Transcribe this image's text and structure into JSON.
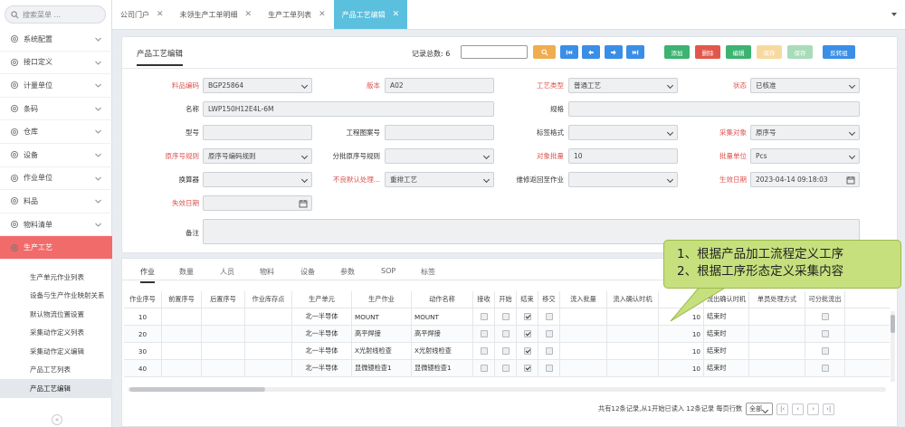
{
  "sidebar": {
    "search_placeholder": "搜索菜单 ...",
    "items": [
      {
        "label": "系统配置",
        "icon": "gear-icon"
      },
      {
        "label": "接口定义",
        "icon": "gear-icon"
      },
      {
        "label": "计量单位",
        "icon": "gear-icon"
      },
      {
        "label": "条码",
        "icon": "gear-icon"
      },
      {
        "label": "仓库",
        "icon": "gear-icon"
      },
      {
        "label": "设备",
        "icon": "gear-icon"
      },
      {
        "label": "作业单位",
        "icon": "gear-icon"
      },
      {
        "label": "料品",
        "icon": "gear-icon"
      },
      {
        "label": "物料清单",
        "icon": "gear-icon"
      },
      {
        "label": "生产工艺",
        "icon": "gear-icon",
        "active": true
      }
    ],
    "subitems": [
      {
        "label": "生产单元作业列表"
      },
      {
        "label": "设备与生产作业映射关系"
      },
      {
        "label": "默认物流位置设置"
      },
      {
        "label": "采集动作定义列表"
      },
      {
        "label": "采集动作定义编辑"
      },
      {
        "label": "产品工艺列表"
      },
      {
        "label": "产品工艺编辑",
        "active": true
      }
    ]
  },
  "tabs": [
    {
      "label": "公司门户"
    },
    {
      "label": "未领生产工单明细"
    },
    {
      "label": "生产工单列表"
    },
    {
      "label": "产品工艺编辑",
      "active": true
    }
  ],
  "panel": {
    "title": "产品工艺编辑",
    "record_label": "记录总数: 6",
    "buttons": [
      {
        "label": "",
        "icon": "search-icon",
        "color": "#f0ad4e"
      },
      {
        "label": "",
        "icon": "first-page-icon",
        "color": "#3a8ee6"
      },
      {
        "label": "",
        "icon": "prev-icon",
        "color": "#3a8ee6"
      },
      {
        "label": "",
        "icon": "next-icon",
        "color": "#3a8ee6"
      },
      {
        "label": "",
        "icon": "last-page-icon",
        "color": "#3a8ee6"
      },
      {
        "label": "添加",
        "color": "#3cb371"
      },
      {
        "label": "删除",
        "color": "#e2574c"
      },
      {
        "label": "编辑",
        "color": "#3cb371"
      },
      {
        "label": "保存",
        "color": "#f7d9a0"
      },
      {
        "label": "保存",
        "color": "#a8dcb8"
      },
      {
        "label": "反转组",
        "color": "#3a8ee6"
      }
    ],
    "fields": {
      "code": {
        "label": "料品编码",
        "value": "BGP25864"
      },
      "version": {
        "label": "版本",
        "value": "A02"
      },
      "route_type": {
        "label": "工艺类型",
        "value": "普通工艺"
      },
      "status": {
        "label": "状态",
        "value": "已核准"
      },
      "name": {
        "label": "名称",
        "value": "LWP150H12E4L-6M"
      },
      "spec": {
        "label": "规格",
        "value": ""
      },
      "model": {
        "label": "型号",
        "value": ""
      },
      "drawing": {
        "label": "工程图案号",
        "value": ""
      },
      "label_fmt": {
        "label": "标签格式",
        "value": ""
      },
      "collect_obj": {
        "label": "采集对象",
        "value": "原序号"
      },
      "serial_rule": {
        "label": "原序号规则",
        "value": "原序号编码规则"
      },
      "sub_serial_rule": {
        "label": "分批原序号规则",
        "value": ""
      },
      "obj_qty": {
        "label": "对象批量",
        "value": "10"
      },
      "batch_unit": {
        "label": "批量单位",
        "value": "Pcs"
      },
      "converter": {
        "label": "换算器",
        "value": ""
      },
      "bad_default": {
        "label": "不良默认处理...",
        "value": "重排工艺"
      },
      "repair_return": {
        "label": "维修返回至作业",
        "value": ""
      },
      "effective": {
        "label": "生效日期",
        "value": "2023-04-14 09:18:03"
      },
      "expire": {
        "label": "失效日期",
        "value": ""
      },
      "remark": {
        "label": "备注",
        "value": ""
      }
    }
  },
  "bottom": {
    "tabs": [
      {
        "label": "作业",
        "active": true
      },
      {
        "label": "数量"
      },
      {
        "label": "人员"
      },
      {
        "label": "物料"
      },
      {
        "label": "设备"
      },
      {
        "label": "参数"
      },
      {
        "label": "SOP"
      },
      {
        "label": "标签"
      }
    ],
    "columns": [
      "作业序号",
      "前置序号",
      "后置序号",
      "作业库存点",
      "生产单元",
      "生产作业",
      "动作名称",
      "接收",
      "开始",
      "结束",
      "移交",
      "流入批量",
      "流入确认时机",
      "",
      "流出确认时机",
      "单员处理方式",
      "可分批流出"
    ],
    "rows": [
      {
        "seq": "10",
        "unit": "北一半导体",
        "op": "MOUNT",
        "act": "MOUNT",
        "end": true,
        "inq": "10",
        "outtime": "结束时"
      },
      {
        "seq": "20",
        "unit": "北一半导体",
        "op": "高平焊接",
        "act": "高平焊接",
        "end": true,
        "inq": "10",
        "outtime": "结束时"
      },
      {
        "seq": "30",
        "unit": "北一半导体",
        "op": "X光射线检查",
        "act": "X光射线检查",
        "end": true,
        "inq": "10",
        "outtime": "结束时"
      },
      {
        "seq": "40",
        "unit": "北一半导体",
        "op": "显微镜检查1",
        "act": "显微镜检查1",
        "end": true,
        "inq": "10",
        "outtime": "结束时"
      }
    ],
    "pager_text": "共有12条记录,从1开始已读入 12条记录 每页行数",
    "page_size": "全部"
  },
  "callout": {
    "line1": "1、根据产品加工流程定义工序",
    "line2": "2、根据工序形态定义采集内容"
  }
}
